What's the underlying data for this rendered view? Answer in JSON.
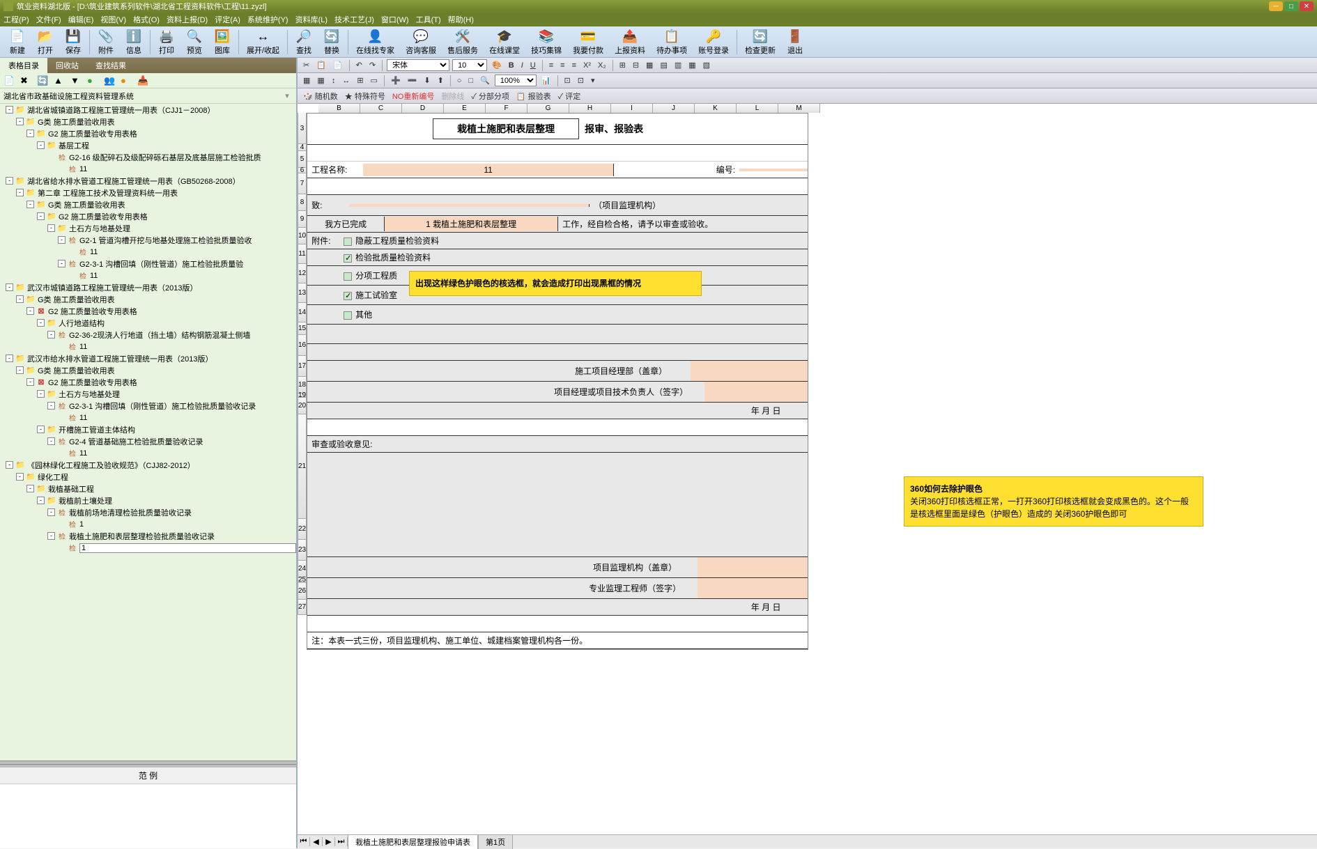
{
  "titlebar": {
    "app_name": "筑业资料湖北版",
    "file_path": "[D:\\筑业建筑系列软件\\湖北省工程资料软件\\工程\\11.zyzl]"
  },
  "menubar": [
    "工程(P)",
    "文件(F)",
    "编辑(E)",
    "视图(V)",
    "格式(O)",
    "资料上报(D)",
    "评定(A)",
    "系统维护(Y)",
    "资料库(L)",
    "技术工艺(J)",
    "窗口(W)",
    "工具(T)",
    "帮助(H)"
  ],
  "toolbar": [
    {
      "icon": "📄",
      "label": "新建"
    },
    {
      "icon": "📂",
      "label": "打开"
    },
    {
      "icon": "💾",
      "label": "保存"
    },
    {
      "icon": "📎",
      "label": "附件"
    },
    {
      "icon": "ℹ️",
      "label": "信息"
    },
    {
      "icon": "🖨️",
      "label": "打印"
    },
    {
      "icon": "🔍",
      "label": "预览"
    },
    {
      "icon": "🖼️",
      "label": "图库"
    },
    {
      "icon": "↔",
      "label": "展开/收起"
    },
    {
      "icon": "🔎",
      "label": "查找"
    },
    {
      "icon": "🔄",
      "label": "替换"
    },
    {
      "icon": "👤",
      "label": "在线找专家"
    },
    {
      "icon": "💬",
      "label": "咨询客服"
    },
    {
      "icon": "🛠️",
      "label": "售后服务"
    },
    {
      "icon": "🎓",
      "label": "在线课堂"
    },
    {
      "icon": "📚",
      "label": "技巧集锦"
    },
    {
      "icon": "💳",
      "label": "我要付款"
    },
    {
      "icon": "📤",
      "label": "上报资料"
    },
    {
      "icon": "📋",
      "label": "待办事项"
    },
    {
      "icon": "🔑",
      "label": "账号登录"
    },
    {
      "icon": "🔄",
      "label": "检查更新"
    },
    {
      "icon": "🚪",
      "label": "退出"
    }
  ],
  "left_tabs": [
    "表格目录",
    "回收站",
    "查找结果"
  ],
  "tree_header": "湖北省市政基础设施工程资料管理系统",
  "tree": [
    {
      "lvl": 0,
      "exp": "-",
      "ico": "folder",
      "txt": "湖北省城镇道路工程施工管理统一用表（CJJ1－2008）"
    },
    {
      "lvl": 1,
      "exp": "-",
      "ico": "folder",
      "txt": "G类 施工质量验收用表"
    },
    {
      "lvl": 2,
      "exp": "-",
      "ico": "folder",
      "txt": "G2 施工质量验收专用表格"
    },
    {
      "lvl": 3,
      "exp": "-",
      "ico": "folder",
      "txt": "基层工程"
    },
    {
      "lvl": 4,
      "exp": "",
      "ico": "leaf",
      "txt": "G2-16 级配碎石及级配碎砾石基层及底基层施工检验批质"
    },
    {
      "lvl": 5,
      "exp": "",
      "ico": "leaf",
      "txt": "11"
    },
    {
      "lvl": 0,
      "exp": "-",
      "ico": "folder",
      "txt": "湖北省给水排水管道工程施工管理统一用表（GB50268-2008）"
    },
    {
      "lvl": 1,
      "exp": "-",
      "ico": "folder",
      "txt": "第二章 工程施工技术及管理资料统一用表"
    },
    {
      "lvl": 2,
      "exp": "-",
      "ico": "folder",
      "txt": "G类 施工质量验收用表"
    },
    {
      "lvl": 3,
      "exp": "-",
      "ico": "folder",
      "txt": "G2 施工质量验收专用表格"
    },
    {
      "lvl": 4,
      "exp": "-",
      "ico": "folder",
      "txt": "土石方与地基处理"
    },
    {
      "lvl": 5,
      "exp": "-",
      "ico": "leaf",
      "txt": "G2-1 管道沟槽开挖与地基处理施工检验批质量验收"
    },
    {
      "lvl": 6,
      "exp": "",
      "ico": "leaf",
      "txt": "11"
    },
    {
      "lvl": 5,
      "exp": "-",
      "ico": "leaf",
      "txt": "G2-3-1 沟槽回填（刚性管道）施工检验批质量验"
    },
    {
      "lvl": 6,
      "exp": "",
      "ico": "leaf",
      "txt": "11"
    },
    {
      "lvl": 0,
      "exp": "-",
      "ico": "folder",
      "txt": "武汉市城镇道路工程施工管理统一用表（2013版）"
    },
    {
      "lvl": 1,
      "exp": "-",
      "ico": "folder",
      "txt": "G类 施工质量验收用表"
    },
    {
      "lvl": 2,
      "exp": "-",
      "ico": "folder-red",
      "txt": "G2 施工质量验收专用表格"
    },
    {
      "lvl": 3,
      "exp": "-",
      "ico": "folder",
      "txt": "人行地道结构"
    },
    {
      "lvl": 4,
      "exp": "-",
      "ico": "leaf",
      "txt": "G2-36-2现浇人行地道（挡土墙）结构钢筋混凝土侧墙"
    },
    {
      "lvl": 5,
      "exp": "",
      "ico": "leaf",
      "txt": "11"
    },
    {
      "lvl": 0,
      "exp": "-",
      "ico": "folder",
      "txt": "武汉市给水排水管道工程施工管理统一用表（2013版）"
    },
    {
      "lvl": 1,
      "exp": "-",
      "ico": "folder",
      "txt": "G类 施工质量验收用表"
    },
    {
      "lvl": 2,
      "exp": "-",
      "ico": "folder-red",
      "txt": "G2 施工质量验收专用表格"
    },
    {
      "lvl": 3,
      "exp": "-",
      "ico": "folder",
      "txt": "土石方与地基处理"
    },
    {
      "lvl": 4,
      "exp": "-",
      "ico": "leaf",
      "txt": "G2-3-1 沟槽回填（刚性管道）施工检验批质量验收记录"
    },
    {
      "lvl": 5,
      "exp": "",
      "ico": "leaf",
      "txt": "11"
    },
    {
      "lvl": 3,
      "exp": "-",
      "ico": "folder",
      "txt": "开槽施工管道主体结构"
    },
    {
      "lvl": 4,
      "exp": "-",
      "ico": "leaf",
      "txt": "G2-4 管道基础施工检验批质量验收记录"
    },
    {
      "lvl": 5,
      "exp": "",
      "ico": "leaf",
      "txt": "11"
    },
    {
      "lvl": 0,
      "exp": "-",
      "ico": "folder",
      "txt": "《园林绿化工程施工及验收规范》（CJJ82-2012）"
    },
    {
      "lvl": 1,
      "exp": "-",
      "ico": "folder",
      "txt": "绿化工程"
    },
    {
      "lvl": 2,
      "exp": "-",
      "ico": "folder",
      "txt": "栽植基础工程"
    },
    {
      "lvl": 3,
      "exp": "-",
      "ico": "folder",
      "txt": "栽植前土壤处理"
    },
    {
      "lvl": 4,
      "exp": "-",
      "ico": "leaf",
      "txt": "栽植前场地清理检验批质量验收记录"
    },
    {
      "lvl": 5,
      "exp": "",
      "ico": "leaf",
      "txt": "1"
    },
    {
      "lvl": 4,
      "exp": "-",
      "ico": "leaf",
      "txt": "栽植土施肥和表层整理检验批质量验收记录"
    },
    {
      "lvl": 5,
      "exp": "",
      "ico": "leaf",
      "txt": "1",
      "sel": true
    }
  ],
  "example_label": "范        例",
  "editor": {
    "font": "宋体",
    "size": "10",
    "zoom": "100%"
  },
  "ed_toolbar3": {
    "random": "随机数",
    "special": "特殊符号",
    "renumber": "NO重新编号",
    "delline": "删除线",
    "subitem": "分部分项",
    "report": "报验表",
    "eval": "评定"
  },
  "columns": [
    "B",
    "C",
    "D",
    "E",
    "F",
    "G",
    "H",
    "I",
    "J",
    "K",
    "L",
    "M"
  ],
  "form": {
    "title_box": "栽植土施肥和表层整理",
    "title_rest": "报审、报验表",
    "project_label": "工程名称:",
    "project_value": "11",
    "number_label": "编号:",
    "to_label": "致:",
    "to_suffix": "（项目监理机构）",
    "done_label": "我方已完成",
    "done_item": "1 栽植土施肥和表层整理",
    "done_suffix": "工作，经自检合格，请予以审查或验收。",
    "attach_label": "附件:",
    "chk1": "隐蔽工程质量检验资料",
    "chk2": "检验批质量检验资料",
    "chk3": "分项工程质",
    "chk4": "施工试验室",
    "chk5": "其他",
    "mgr_dept": "施工项目经理部（盖章）",
    "mgr_sign": "项目经理或项目技术负责人（签字）",
    "date1": "年  月  日",
    "review_label": "审查或验收意见:",
    "supervision_org": "项目监理机构（盖章）",
    "supervisor_sign": "专业监理工程师（签字）",
    "date2": "年  月  日",
    "note": "注：本表一式三份，项目监理机构、施工单位、城建档案管理机构各一份。"
  },
  "yellow_note1": "出现这样绿色护眼色的核选框，就会造成打印出现黑框的情况",
  "yellow_note2_title": "360如何去除护眼色",
  "yellow_note2_body": "关闭360打印核选框正常，一打开360打印核选框就会变成黑色的。这个一般是核选框里面是绿色（护眼色）造成的 关闭360护眼色即可",
  "sheet_tabs": [
    "栽植土施肥和表层整理报验申请表",
    "第1页"
  ]
}
